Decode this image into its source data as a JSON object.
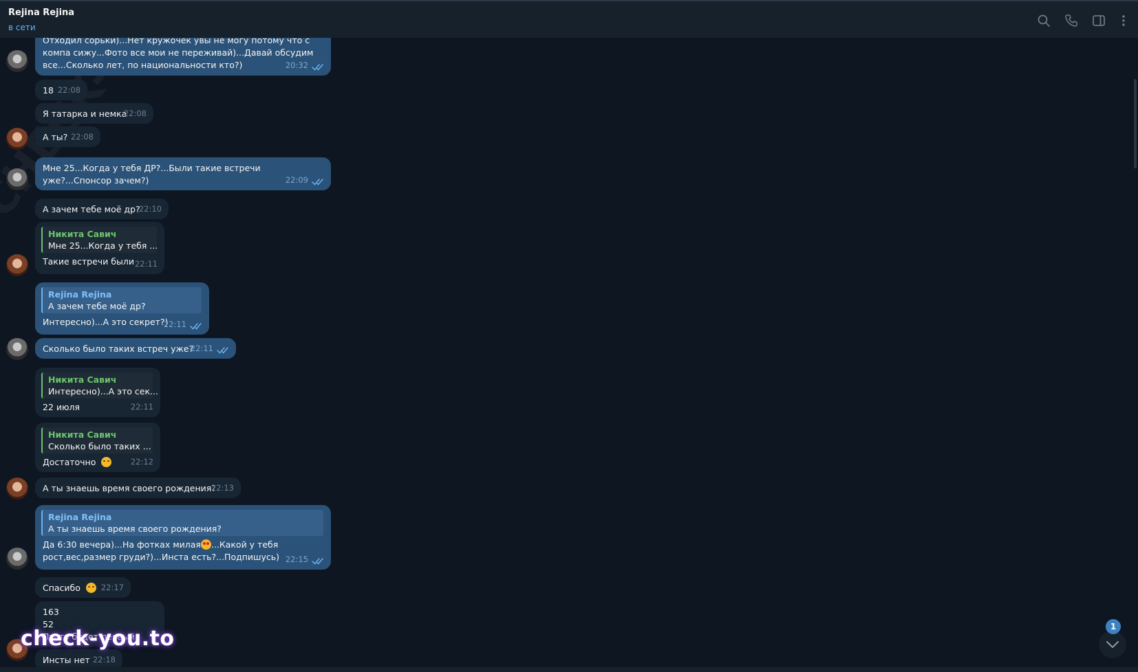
{
  "header": {
    "title": "Rejina Rejina",
    "status": "в сети"
  },
  "icons": {
    "search": "search-icon",
    "call": "phone-icon",
    "sidebar": "sidebar-toggle-icon",
    "more": "more-vertical-icon"
  },
  "watermarks": {
    "diagonal": "CHECK-YOU.ME",
    "bottom": "check-you.to"
  },
  "messages": [
    {
      "id": 0,
      "dir": "out",
      "text": "Отходил сорьки)...Нет кружочек увы не могу потому что с компа сижу...Фото все мои не переживай)...Давай обсудим все...Сколько лет, по национальности кто?)",
      "time": "20:32"
    },
    {
      "id": 1,
      "dir": "in",
      "text": "18",
      "time": "22:08"
    },
    {
      "id": 2,
      "dir": "in",
      "text": "Я татарка и немка",
      "time": "22:08"
    },
    {
      "id": 3,
      "dir": "in",
      "text": "А ты?",
      "time": "22:08"
    },
    {
      "id": 4,
      "dir": "out",
      "text": "Мне 25...Когда у тебя ДР?...Были такие встречи уже?...Спонсор зачем?)",
      "time": "22:09"
    },
    {
      "id": 5,
      "dir": "in",
      "text": "А зачем тебе моё др?",
      "time": "22:10"
    },
    {
      "id": 6,
      "dir": "in",
      "reply_name": "Никита Савич",
      "reply_text": "Мне 25...Когда у тебя ...",
      "text": "Такие встречи были",
      "time": "22:11"
    },
    {
      "id": 7,
      "dir": "out",
      "reply_name": "Rejina Rejina",
      "reply_text": "А зачем тебе моё др?",
      "text": "Интересно)...А это секрет?)",
      "time": "22:11"
    },
    {
      "id": 8,
      "dir": "out",
      "text": "Сколько было таких встреч уже?",
      "time": "22:11"
    },
    {
      "id": 9,
      "dir": "in",
      "reply_name": "Никита Савич",
      "reply_text": "Интересно)...А это сек...",
      "text": "22 июля",
      "time": "22:11"
    },
    {
      "id": 10,
      "dir": "in",
      "reply_name": "Никита Савич",
      "reply_text": "Сколько было таких ...",
      "text": "Достаточно",
      "emoji": "smirking-face",
      "time": "22:12"
    },
    {
      "id": 11,
      "dir": "in",
      "text": "А ты знаешь время своего рождения?",
      "time": "22:13"
    },
    {
      "id": 12,
      "dir": "out",
      "reply_name": "Rejina Rejina",
      "reply_text": "А ты знаешь время своего рождения?",
      "text_before": "Да 6:30 вечера)...На фотках милая",
      "emoji": "heart-eyes",
      "text_after": "...Какой у тебя рост,вес,размер груди?)...Инста есть?...Подпишусь)",
      "time": "22:15"
    },
    {
      "id": 13,
      "dir": "in",
      "text": "Спасибо",
      "emoji": "smiling-face",
      "time": "22:17"
    },
    {
      "id": 14,
      "dir": "in",
      "lines": [
        "163",
        "52",
        "Пусть будет первый"
      ]
    },
    {
      "id": 15,
      "dir": "in",
      "text": "Инсты нет",
      "time": "22:18"
    }
  ],
  "scroll": {
    "unread_count": "1"
  },
  "colors": {
    "background": "#0e1621",
    "header": "#17212b",
    "incoming_bubble": "#182533",
    "outgoing_bubble": "#2b5278",
    "accent": "#5eb5f7",
    "reply_name_green": "#6bc46d"
  }
}
